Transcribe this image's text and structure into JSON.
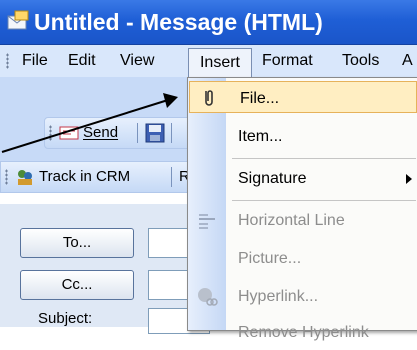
{
  "window": {
    "title": "Untitled - Message (HTML)"
  },
  "menubar": {
    "items": [
      "File",
      "Edit",
      "View",
      "Insert",
      "Format",
      "Tools",
      "A"
    ]
  },
  "toolbar": {
    "send_label": "Send"
  },
  "crm_toolbar": {
    "track_label": "Track in CRM",
    "next_label": "R"
  },
  "form": {
    "to_label": "To...",
    "cc_label": "Cc...",
    "subject_label": "Subject:"
  },
  "insert_menu": {
    "items": [
      {
        "label": "File...",
        "enabled": true
      },
      {
        "label": "Item...",
        "enabled": true
      },
      {
        "label": "Signature",
        "enabled": true
      },
      {
        "label": "Horizontal Line",
        "enabled": false
      },
      {
        "label": "Picture...",
        "enabled": false
      },
      {
        "label": "Hyperlink...",
        "enabled": false
      },
      {
        "label": "Remove Hyperlink",
        "enabled": false
      }
    ]
  },
  "colors": {
    "title_bar": "#1f5fd6",
    "menu_bar": "#d9e7fb",
    "highlight": "#ffeec2"
  }
}
